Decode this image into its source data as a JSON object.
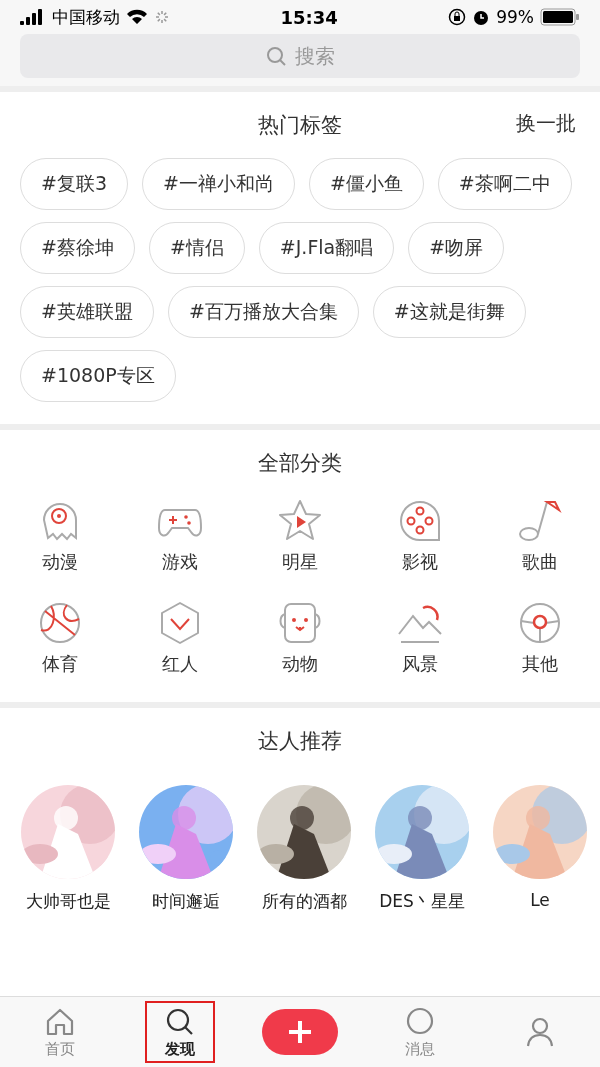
{
  "status_bar": {
    "carrier": "中国移动",
    "time": "15:34",
    "battery": "99%"
  },
  "search": {
    "placeholder": "搜索"
  },
  "hot_tags": {
    "title": "热门标签",
    "refresh": "换一批",
    "tags": [
      "#复联3",
      "#一禅小和尚",
      "#僵小鱼",
      "#茶啊二中",
      "#蔡徐坤",
      "#情侣",
      "#J.Fla翻唱",
      "#吻屏",
      "#英雄联盟",
      "#百万播放大合集",
      "#这就是街舞",
      "#1080P专区"
    ]
  },
  "categories": {
    "title": "全部分类",
    "items": [
      {
        "label": "动漫",
        "kind": "ghost"
      },
      {
        "label": "游戏",
        "kind": "gamepad"
      },
      {
        "label": "明星",
        "kind": "star"
      },
      {
        "label": "影视",
        "kind": "film"
      },
      {
        "label": "歌曲",
        "kind": "note"
      },
      {
        "label": "体育",
        "kind": "ball"
      },
      {
        "label": "红人",
        "kind": "hexagon"
      },
      {
        "label": "动物",
        "kind": "animal"
      },
      {
        "label": "风景",
        "kind": "mountain"
      },
      {
        "label": "其他",
        "kind": "wheel"
      }
    ]
  },
  "recommend": {
    "title": "达人推荐",
    "users": [
      {
        "name": "大帅哥也是",
        "kind": "pink"
      },
      {
        "name": "时间邂逅",
        "kind": "galaxy"
      },
      {
        "name": "所有的酒都",
        "kind": "dark"
      },
      {
        "name": "DES丶星星",
        "kind": "sky"
      },
      {
        "name": "Le",
        "kind": "peach"
      }
    ]
  },
  "tab_bar": [
    {
      "kind": "home",
      "label": "首页",
      "selected": false
    },
    {
      "kind": "search",
      "label": "发现",
      "selected": true
    },
    {
      "kind": "add",
      "selected": false
    },
    {
      "kind": "message",
      "label": "消息",
      "selected": false
    },
    {
      "kind": "person",
      "selected": false
    }
  ]
}
